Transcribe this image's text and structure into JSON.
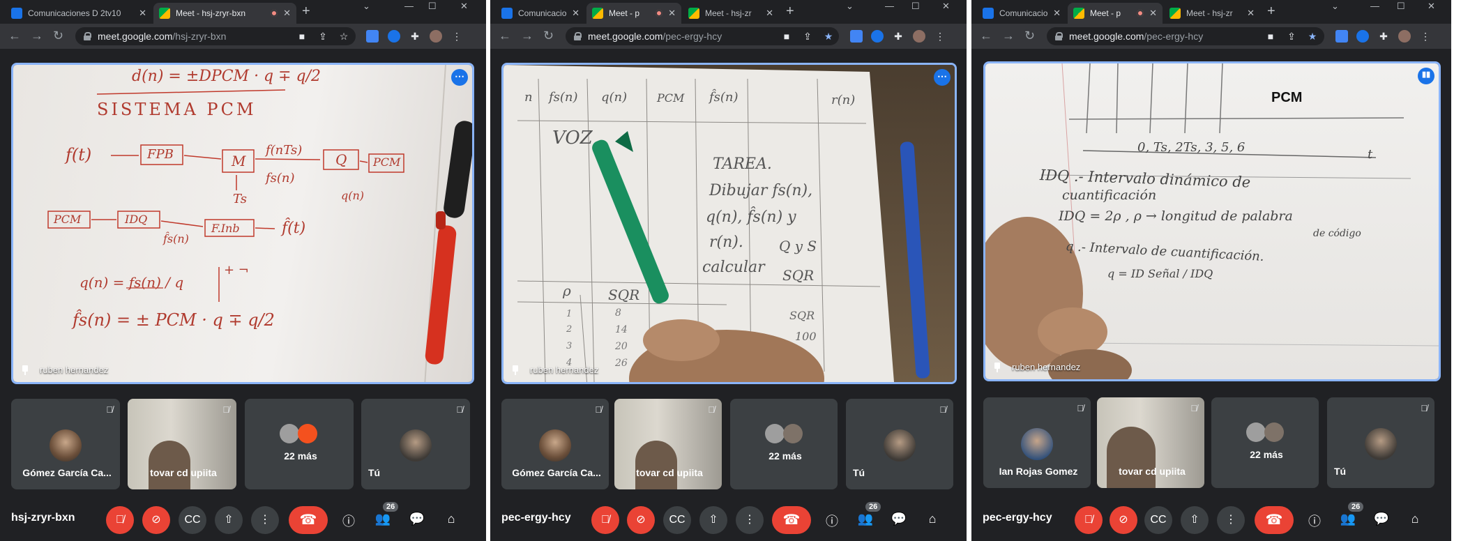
{
  "windows": [
    {
      "tabs": [
        {
          "title": "Comunicaciones D 2tv10",
          "recording": false
        },
        {
          "title": "Meet - hsj-zryr-bxn",
          "recording": true
        }
      ],
      "url": {
        "host": "meet.google.com",
        "path": "/hsj-zryr-bxn"
      },
      "meeting_code": "hsj-zryr-bxn",
      "main_presenter": "ruben hernandez",
      "participants": [
        "Gómez García Ca...",
        "tovar cd upiita",
        "22 más",
        "Tú"
      ],
      "participant_count": "26",
      "notes": {
        "top_formula": "d(n) = ±DPCM · q ∓ q/2",
        "title": "SISTEMA PCM",
        "row1": [
          "f(t)",
          "FPB",
          "M",
          "f(nTs)",
          "Q",
          "PCM"
        ],
        "sampling": "Ts",
        "fs_label": "fs(n)",
        "qn_label": "q(n)",
        "row2": [
          "PCM",
          "IDQ",
          "F.Inb",
          "f̂(t)"
        ],
        "fhat_label": "f̂s(n)",
        "eq1": "q(n) = fs(n) / q",
        "eq1_bracket": "+ ¬",
        "eq2": "f̂s(n) = ± PCM · q ∓ q/2"
      }
    },
    {
      "tabs": [
        {
          "title": "Comunicacio",
          "recording": false
        },
        {
          "title": "Meet - p",
          "recording": true
        },
        {
          "title": "Meet - hsj-zr",
          "recording": false
        }
      ],
      "url": {
        "host": "meet.google.com",
        "path": "/pec-ergy-hcy"
      },
      "meeting_code": "pec-ergy-hcy",
      "main_presenter": "ruben hernandez",
      "participants": [
        "Gómez García Ca...",
        "tovar cd upiita",
        "22 más",
        "Tú"
      ],
      "participant_count": "26",
      "notes": {
        "headers": [
          "n",
          "fs(n)",
          "q(n)",
          "PCM",
          "f̂s(n)",
          "r(n)"
        ],
        "voz": "VOZ",
        "task_lines": [
          "TAREA.",
          "Dibujar fs(n),",
          "q(n), f̂s(n) y",
          "r(n).",
          "calcular"
        ],
        "qs": "Q y S",
        "sqr": "SQR",
        "lower_headers": [
          "ρ",
          "SQR"
        ],
        "lower_rows": [
          "1",
          "2",
          "3",
          "4"
        ],
        "lower_values": [
          "8",
          "14",
          "20",
          "26"
        ],
        "right_col": [
          "SQR",
          "100"
        ]
      }
    },
    {
      "tabs": [
        {
          "title": "Comunicacio",
          "recording": false
        },
        {
          "title": "Meet - p",
          "recording": true
        },
        {
          "title": "Meet - hsj-zr",
          "recording": false
        }
      ],
      "url": {
        "host": "meet.google.com",
        "path": "/pec-ergy-hcy"
      },
      "meeting_code": "pec-ergy-hcy",
      "main_presenter": "ruben hernandez",
      "participants": [
        "Ian Rojas Gomez",
        "tovar cd upiita",
        "22 más",
        "Tú"
      ],
      "participant_count": "26",
      "overlay_title": "PCM",
      "notes": {
        "axis": "0, Ts, 2Ts, 3, 5, 6",
        "t": "t",
        "line1": "IDQ .- Intervalo dinámico de",
        "line2": "cuantificación",
        "line3": "IDQ = 2ρ ,   ρ → longitud de palabra",
        "line3b": "de código",
        "line4": "q .- Intervalo de cuantificación.",
        "line5": "q = ID Señal / IDQ"
      }
    }
  ],
  "colors": {
    "accent_blue": "#8ab4f8",
    "end_call_red": "#ea4335",
    "meet_bg": "#202124",
    "tile_bg": "#3c4043"
  }
}
